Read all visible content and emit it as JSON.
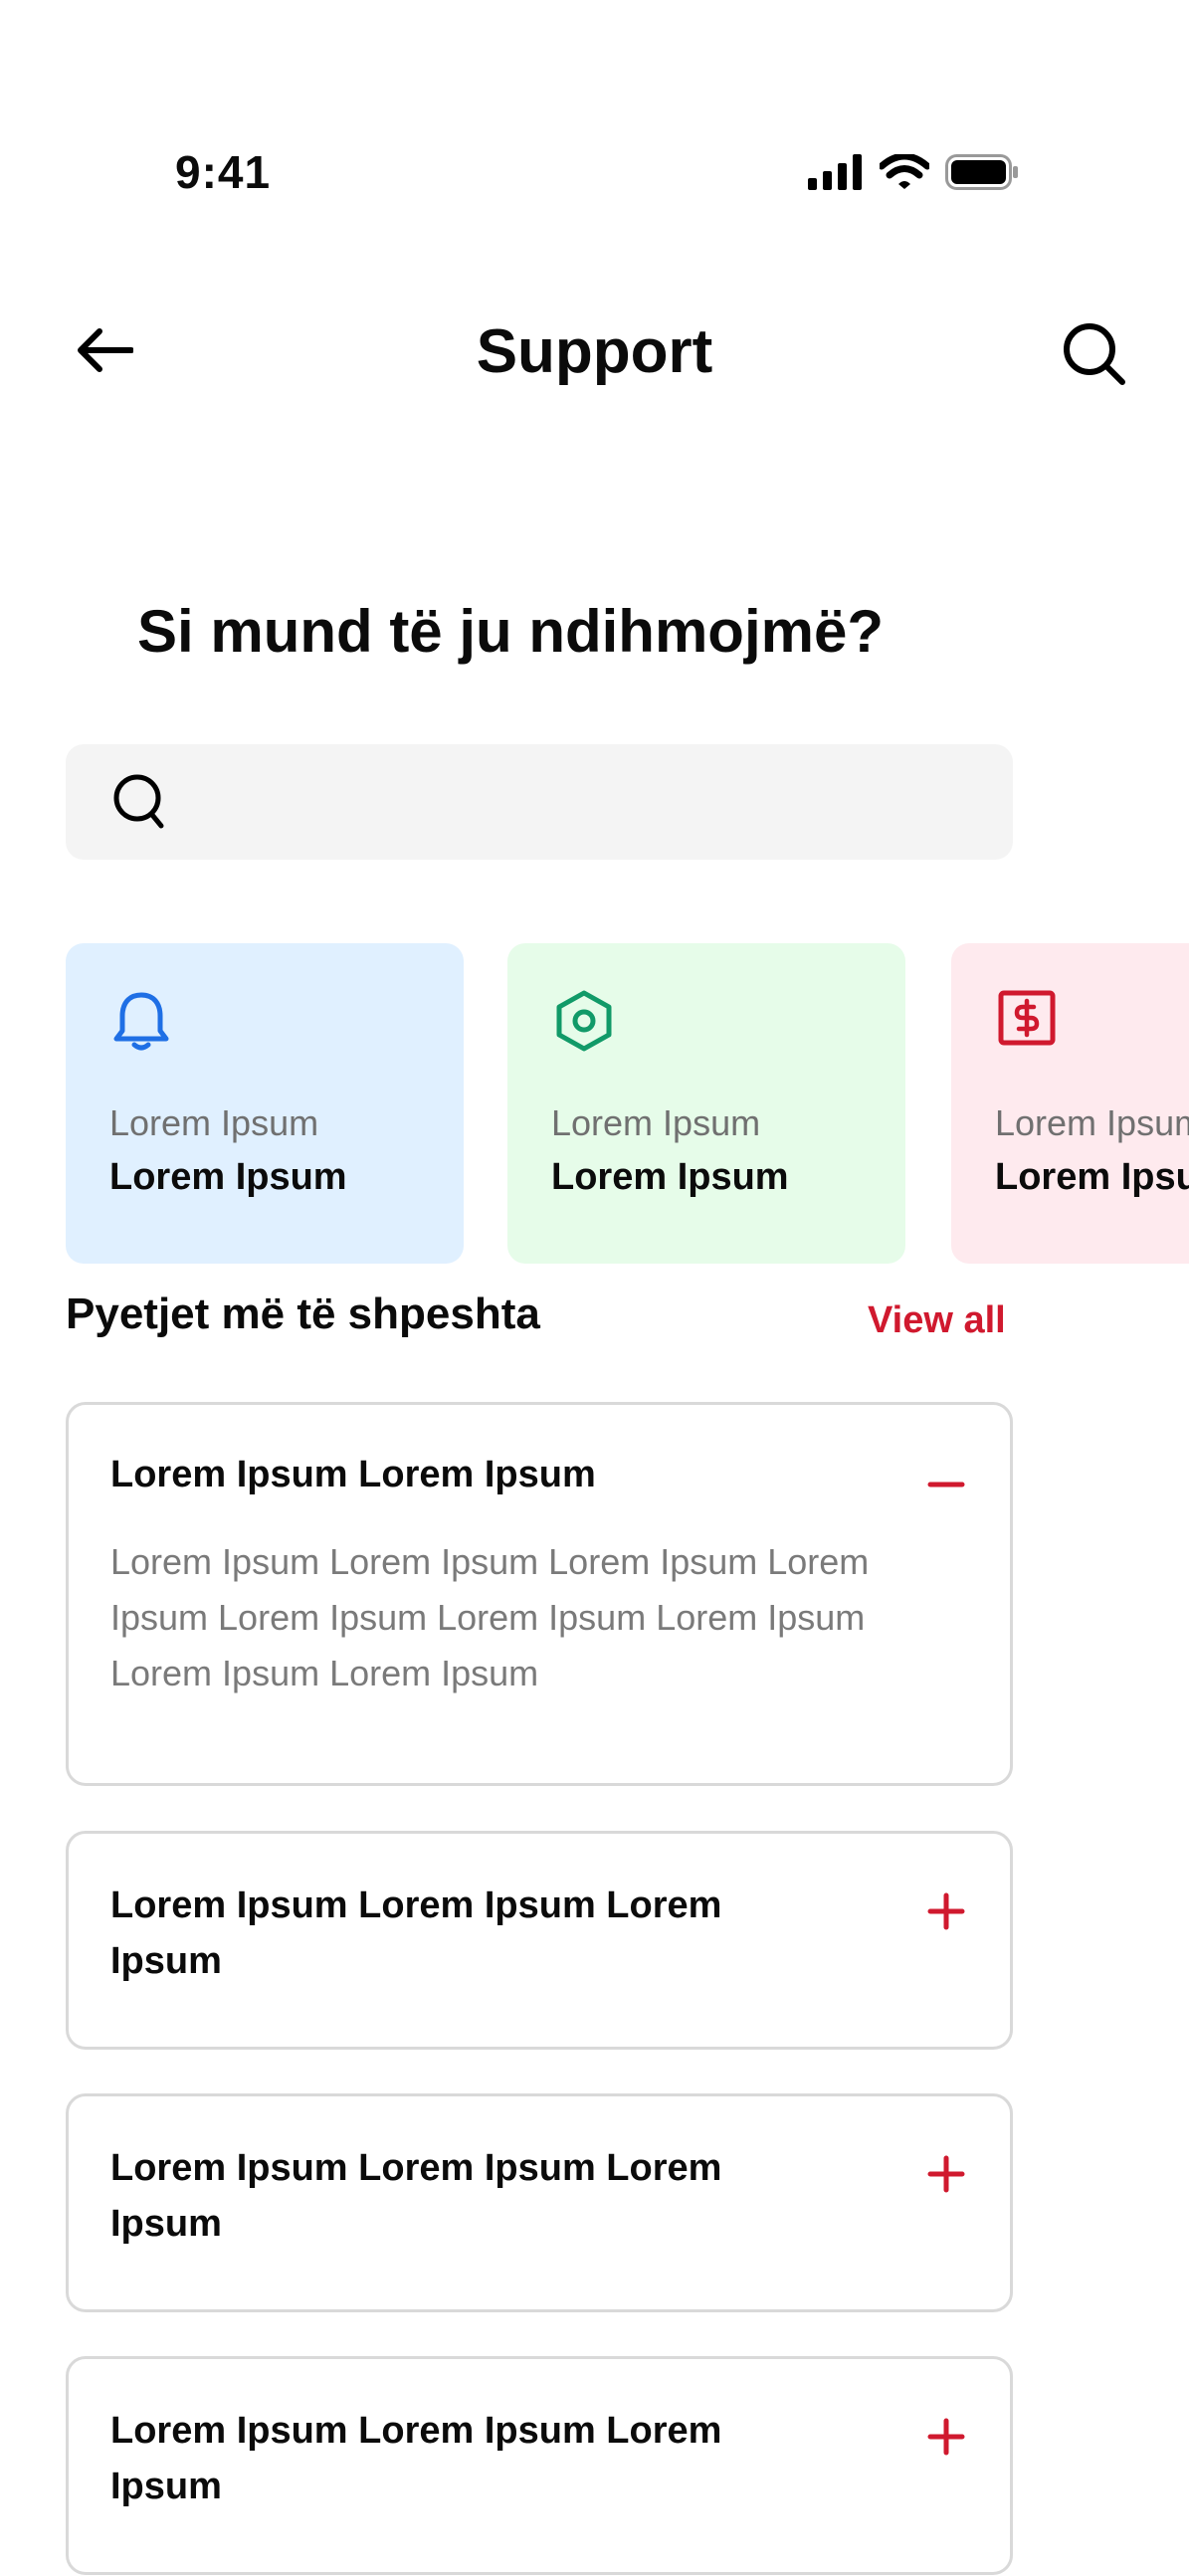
{
  "status_bar": {
    "time": "9:41"
  },
  "header": {
    "title": "Support"
  },
  "heading": "Si mund të ju ndihmojmë?",
  "search": {
    "placeholder": ""
  },
  "categories": [
    {
      "subtitle": "Lorem Ipsum",
      "title": "Lorem Ipsum",
      "bg": "#e0f0ff",
      "color": "#1f6fe5",
      "icon": "bell-icon"
    },
    {
      "subtitle": "Lorem Ipsum",
      "title": "Lorem Ipsum",
      "bg": "#e6fce9",
      "color": "#119a68",
      "icon": "hexagon-settings-icon"
    },
    {
      "subtitle": "Lorem Ipsum",
      "title": "Lorem Ipsum",
      "bg": "#feeaee",
      "color": "#d0192e",
      "icon": "dollar-receipt-icon"
    }
  ],
  "faq": {
    "title": "Pyetjet më të shpeshta",
    "view_all": "View all",
    "accent": "#d0192e",
    "items": [
      {
        "question": "Lorem Ipsum Lorem Ipsum",
        "answer": "Lorem Ipsum Lorem Ipsum Lorem Ipsum Lorem Ipsum Lorem Ipsum Lorem Ipsum Lorem Ipsum Lorem Ipsum Lorem Ipsum",
        "expanded": true
      },
      {
        "question": " Lorem Ipsum Lorem Ipsum Lorem Ipsum",
        "expanded": false
      },
      {
        "question": " Lorem Ipsum Lorem Ipsum Lorem Ipsum",
        "expanded": false
      },
      {
        "question": " Lorem Ipsum Lorem Ipsum Lorem Ipsum",
        "expanded": false
      }
    ]
  }
}
